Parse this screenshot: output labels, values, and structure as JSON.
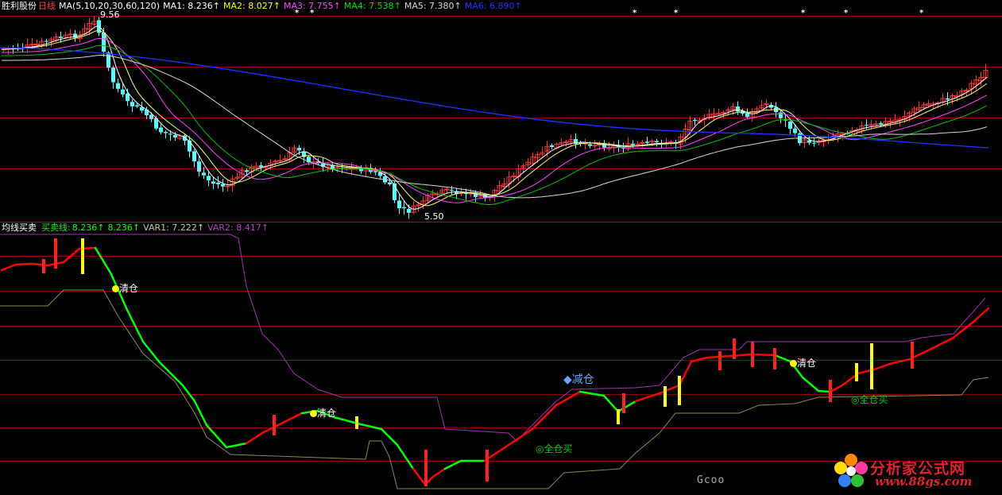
{
  "header": {
    "stock_name": "胜利股份",
    "period": "日线",
    "ma_params": "MA(5,10,20,30,60,120)",
    "items": [
      {
        "label": "MA1:",
        "value": "8.236",
        "arrow": "↑",
        "color": "#ffffff"
      },
      {
        "label": "MA2:",
        "value": "8.027",
        "arrow": "↑",
        "color": "#ffff00"
      },
      {
        "label": "MA3:",
        "value": "7.755",
        "arrow": "↑",
        "color": "#ff40ff"
      },
      {
        "label": "MA4:",
        "value": "7.538",
        "arrow": "↑",
        "color": "#00e000"
      },
      {
        "label": "MA5:",
        "value": "7.380",
        "arrow": "↑",
        "color": "#d8d8d8"
      },
      {
        "label": "MA6:",
        "value": "6.890",
        "arrow": "↑",
        "color": "#2030ff"
      }
    ]
  },
  "price_panel": {
    "high_label": "9.56",
    "low_label": "5.50",
    "star_markers": [
      "*",
      "*",
      "*",
      "*",
      "*",
      "*",
      "*"
    ]
  },
  "indicator_panel": {
    "name": "均线买卖",
    "line_label": "买卖线:",
    "items": [
      {
        "label": "",
        "value": "8.236",
        "arrow": "↑",
        "color": "#00ff00"
      },
      {
        "label": "",
        "value": "8.236",
        "arrow": "↑",
        "color": "#00ff00"
      },
      {
        "label": "VAR1:",
        "value": "7.222",
        "arrow": "↑",
        "color": "#c8c89a"
      },
      {
        "label": "VAR2:",
        "value": "8.417",
        "arrow": "↑",
        "color": "#b040c0"
      }
    ],
    "signals": {
      "clear1": "清仓",
      "clear2": "清仓",
      "clear3": "清仓",
      "reduce": "◆减仓",
      "buy1": "◎全仓买",
      "buy2": "◎全仓买"
    }
  },
  "colors": {
    "up": "#ff3232",
    "down": "#54ffff",
    "grid": "#8a0000",
    "buyline_up": "#ff0000",
    "buyline_down": "#00ff00"
  },
  "watermark": {
    "title": "分析家公式网",
    "url": "www.88gs.com",
    "left_text": "Gcoo"
  }
}
